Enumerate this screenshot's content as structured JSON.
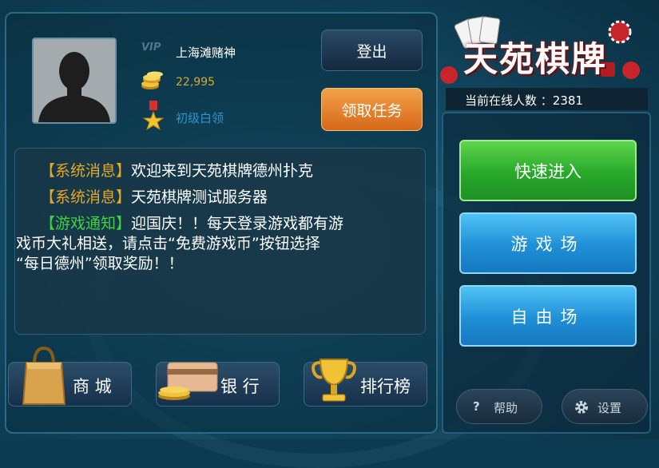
{
  "logo": {
    "title": "天苑棋牌"
  },
  "online": {
    "label": "当前在线人数 ：",
    "count": "2381"
  },
  "user": {
    "vip_label": "VIP",
    "name": "上海滩赌神",
    "coins": "22,995",
    "rank": "初级白领"
  },
  "buttons": {
    "logout": "登出",
    "task": "领取任务"
  },
  "messages": [
    {
      "tag": "【系统消息】",
      "text": "欢迎来到天苑棋牌德州扑克"
    },
    {
      "tag": "【系统消息】",
      "text": "天苑棋牌测试服务器"
    },
    {
      "tag": "【游戏通知】",
      "line1": "迎国庆！！每天登录游戏都有游",
      "line2": "戏币大礼相送，请点击“免费游戏币”按钮选择",
      "line3": "“每日德州”领取奖励！！"
    }
  ],
  "bottom": {
    "shop": "商 城",
    "bank": "银 行",
    "rank": "排行榜"
  },
  "rooms": {
    "quick": "快速进入",
    "game": "游戏场",
    "free": "自由场"
  },
  "footer": {
    "help": "帮助",
    "settings": "设置"
  },
  "colors": {
    "accent_orange": "#e7a826",
    "notice_green": "#3fd23f",
    "quick_green": "#28a82a",
    "room_blue": "#1f8fd6"
  }
}
